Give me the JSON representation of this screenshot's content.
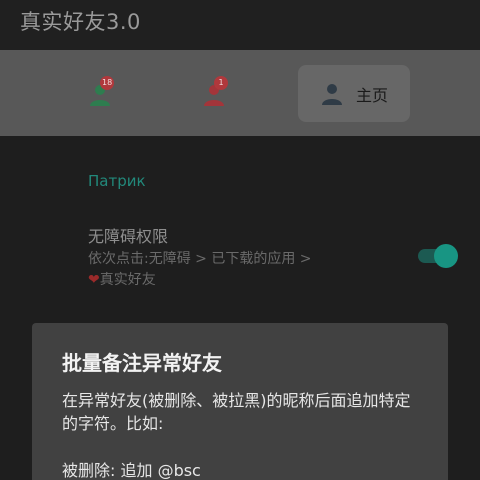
{
  "app": {
    "title": "真实好友3.0"
  },
  "tabs": [
    {
      "icon": "friend-icon",
      "badge": "18",
      "color": "#2e7d4f"
    },
    {
      "icon": "friend-icon",
      "badge": "1",
      "color": "#a3353a"
    },
    {
      "icon": "person-icon",
      "label": "主页",
      "selected": true,
      "color": "#2f3b46"
    }
  ],
  "account": {
    "name": "Патрик"
  },
  "accessibility": {
    "title": "无障碍权限",
    "desc_path": "依次点击:无障碍 > 已下载的应用 >",
    "heart": "❤",
    "desc_app": "真实好友",
    "enabled": true
  },
  "dialog": {
    "title": "批量备注异常好友",
    "body": "在异常好友(被删除、被拉黑)的昵称后面追加特定的字符。比如:",
    "example": "被删除: 追加 @bsc"
  },
  "colors": {
    "accent": "#189583",
    "badge": "#b0383c",
    "tabbar": "#585858",
    "dialog": "#414141"
  }
}
